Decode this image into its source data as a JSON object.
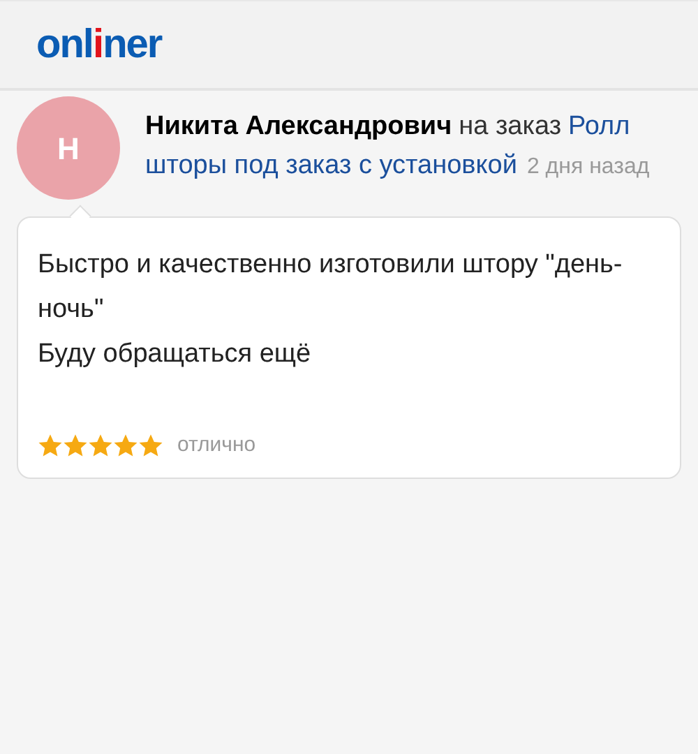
{
  "header": {
    "logo": [
      {
        "text": "onl",
        "accent": false
      },
      {
        "text": "i",
        "accent": true
      },
      {
        "text": "ner",
        "accent": false
      }
    ]
  },
  "review": {
    "avatar_letter": "Н",
    "author": "Никита Александрович",
    "connector": "на заказ",
    "order_link_lines": [
      "Ролл",
      "шторы под заказ с установкой"
    ],
    "time": "2 дня назад",
    "lines": [
      "Быстро и качественно изготовили штору \"день-ночь\"",
      "Буду обращаться ещё"
    ],
    "stars": 5,
    "rating_label": "отлично"
  }
}
